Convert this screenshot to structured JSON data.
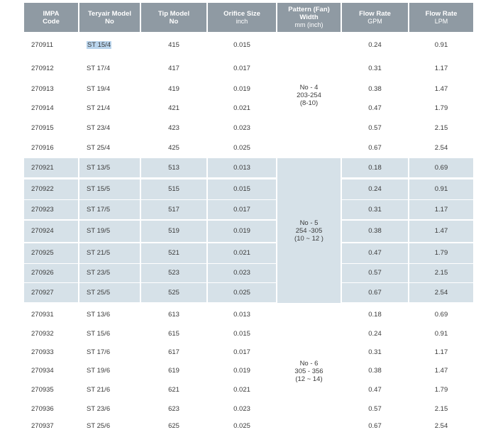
{
  "headers": [
    {
      "main": "IMPA",
      "sub": "Code"
    },
    {
      "main": "Teryair Model",
      "sub": "No"
    },
    {
      "main": "Tip Model",
      "sub": "No"
    },
    {
      "main": "Orifice Size",
      "sub": "inch"
    },
    {
      "main": "Pattern (Fan)",
      "main2": "Width",
      "sub": "mm (inch)"
    },
    {
      "main": "Flow Rate",
      "sub": "GPM"
    },
    {
      "main": "Flow Rate",
      "sub": "LPM"
    }
  ],
  "groups": [
    {
      "pattern": [
        "No - 4",
        "203-254",
        "(8-10)"
      ],
      "rows": [
        {
          "impa": "270911",
          "model": "ST 15/4",
          "tip": "415",
          "orifice": "0.015",
          "gpm": "0.24",
          "lpm": "0.91"
        },
        {
          "impa": "270912",
          "model": "ST 17/4",
          "tip": "417",
          "orifice": "0.017",
          "gpm": "0.31",
          "lpm": "1.17"
        },
        {
          "impa": "270913",
          "model": "ST 19/4",
          "tip": "419",
          "orifice": "0.019",
          "gpm": "0.38",
          "lpm": "1.47"
        },
        {
          "impa": "270914",
          "model": "ST 21/4",
          "tip": "421",
          "orifice": "0.021",
          "gpm": "0.47",
          "lpm": "1.79"
        },
        {
          "impa": "270915",
          "model": "ST 23/4",
          "tip": "423",
          "orifice": "0.023",
          "gpm": "0.57",
          "lpm": "2.15"
        },
        {
          "impa": "270916",
          "model": "ST 25/4",
          "tip": "425",
          "orifice": "0.025",
          "gpm": "0.67",
          "lpm": "2.54"
        }
      ]
    },
    {
      "pattern": [
        "No - 5",
        "254 -305",
        "(10 ~ 12 )"
      ],
      "rows": [
        {
          "impa": "270921",
          "model": "ST 13/5",
          "tip": "513",
          "orifice": "0.013",
          "gpm": "0.18",
          "lpm": "0.69"
        },
        {
          "impa": "270922",
          "model": "ST 15/5",
          "tip": "515",
          "orifice": "0.015",
          "gpm": "0.24",
          "lpm": "0.91"
        },
        {
          "impa": "270923",
          "model": "ST 17/5",
          "tip": "517",
          "orifice": "0.017",
          "gpm": "0.31",
          "lpm": "1.17"
        },
        {
          "impa": "270924",
          "model": "ST 19/5",
          "tip": "519",
          "orifice": "0.019",
          "gpm": "0.38",
          "lpm": "1.47"
        },
        {
          "impa": "270925",
          "model": "ST 21/5",
          "tip": "521",
          "orifice": "0.021",
          "gpm": "0.47",
          "lpm": "1.79"
        },
        {
          "impa": "270926",
          "model": "ST 23/5",
          "tip": "523",
          "orifice": "0.023",
          "gpm": "0.57",
          "lpm": "2.15"
        },
        {
          "impa": "270927",
          "model": "ST 25/5",
          "tip": "525",
          "orifice": "0.025",
          "gpm": "0.67",
          "lpm": "2.54"
        }
      ]
    },
    {
      "pattern": [
        "No - 6",
        "305 - 356",
        "(12 ~ 14)"
      ],
      "rows": [
        {
          "impa": "270931",
          "model": "ST 13/6",
          "tip": "613",
          "orifice": "0.013",
          "gpm": "0.18",
          "lpm": "0.69"
        },
        {
          "impa": "270932",
          "model": "ST 15/6",
          "tip": "615",
          "orifice": "0.015",
          "gpm": "0.24",
          "lpm": "0.91"
        },
        {
          "impa": "270933",
          "model": "ST 17/6",
          "tip": "617",
          "orifice": "0.017",
          "gpm": "0.31",
          "lpm": "1.17"
        },
        {
          "impa": "270934",
          "model": "ST 19/6",
          "tip": "619",
          "orifice": "0.019",
          "gpm": "0.38",
          "lpm": "1.47"
        },
        {
          "impa": "270935",
          "model": "ST 21/6",
          "tip": "621",
          "orifice": "0.021",
          "gpm": "0.47",
          "lpm": "1.79"
        },
        {
          "impa": "270936",
          "model": "ST 23/6",
          "tip": "623",
          "orifice": "0.023",
          "gpm": "0.57",
          "lpm": "2.15"
        },
        {
          "impa": "270937",
          "model": "ST 25/6",
          "tip": "625",
          "orifice": "0.025",
          "gpm": "0.67",
          "lpm": "2.54"
        }
      ]
    }
  ],
  "colors": {
    "header_bg": "#8f9aa3",
    "shade_bg": "#d6e1e8",
    "text": "#3a3a3a",
    "selection": "#b9d4ec"
  }
}
